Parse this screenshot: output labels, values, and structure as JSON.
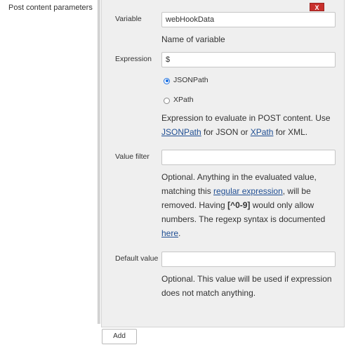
{
  "section": {
    "title": "Post content parameters"
  },
  "remove_button": {
    "label": "X"
  },
  "variable": {
    "label": "Variable",
    "value": "webHookData",
    "help": "Name of variable"
  },
  "expression": {
    "label": "Expression",
    "value": "$",
    "options": [
      {
        "label": "JSONPath",
        "selected": true
      },
      {
        "label": "XPath",
        "selected": false
      }
    ],
    "help": {
      "prefix": "Expression to evaluate in POST content. Use",
      "link1": "JSONPath",
      "middle": "for JSON or",
      "link2": "XPath",
      "suffix": "for XML."
    }
  },
  "value_filter": {
    "label": "Value filter",
    "value": "",
    "help": {
      "part1": "Optional. Anything in the evaluated value, matching this",
      "link_regex": "regular expression",
      "part2": ", will be removed. Having",
      "code": "[^0-9]",
      "part3": "would only allow numbers. The regexp syntax is documented",
      "link_here": "here",
      "part4": "."
    }
  },
  "default_value": {
    "label": "Default value",
    "value": "",
    "help": "Optional. This value will be used if expression does not match anything."
  },
  "add_button": {
    "label": "Add"
  }
}
